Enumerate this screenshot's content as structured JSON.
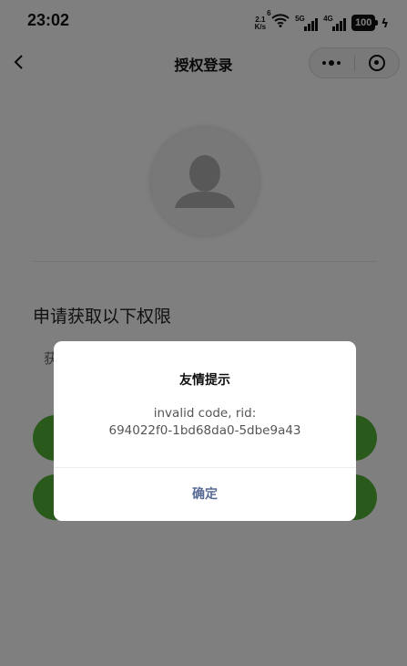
{
  "status_bar": {
    "time": "23:02",
    "net_speed_value": "2.1",
    "net_speed_unit": "K/s",
    "wifi_label": "6",
    "sim1_label": "5G",
    "sim2_label": "4G",
    "battery": "100",
    "charging_glyph": "ϟ"
  },
  "nav": {
    "back_glyph": "<",
    "title": "授权登录"
  },
  "content": {
    "permission_title": "申请获取以下权限",
    "permission_item_partial": "获"
  },
  "dialog": {
    "title": "友情提示",
    "message_line1": "invalid code, rid:",
    "message_line2": "694022f0-1bd68da0-5dbe9a43",
    "confirm_label": "确定",
    "accent_color": "#576b95"
  },
  "colors": {
    "primary_button": "#52b337",
    "mask": "rgba(0,0,0,0.5)"
  }
}
